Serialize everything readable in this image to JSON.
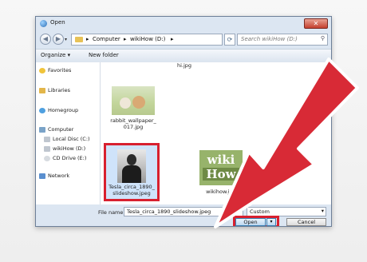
{
  "window": {
    "title": "Open",
    "close_glyph": "✕"
  },
  "address": {
    "back_glyph": "◀",
    "forward_glyph": "▶",
    "crumbs": [
      "Computer",
      "wikiHow (D:)"
    ],
    "separator": "▸",
    "refresh_glyph": "⟳",
    "search_placeholder": "Search wikiHow (D:)",
    "search_glyph": "⚲"
  },
  "toolbar": {
    "organize": "Organize ▾",
    "new_folder": "New folder"
  },
  "sidebar": {
    "items": [
      {
        "label": "Favorites",
        "icon": "star-icon"
      },
      {
        "label": "Libraries",
        "icon": "library-icon"
      },
      {
        "label": "Homegroup",
        "icon": "homegroup-icon"
      },
      {
        "label": "Computer",
        "icon": "computer-icon"
      },
      {
        "label": "Local Disc (C:)",
        "icon": "disk-icon"
      },
      {
        "label": "wikiHow (D:)",
        "icon": "disk-icon"
      },
      {
        "label": "CD Drive (E:)",
        "icon": "cd-icon"
      },
      {
        "label": "Network",
        "icon": "network-icon"
      }
    ]
  },
  "files": {
    "top_partial": "hi.jpg",
    "rabbit": {
      "line1": "rabbit_wallpaper_",
      "line2": "017.jpg"
    },
    "tesla": {
      "line1": "Tesla_circa_1890_",
      "line2": "slideshow.jpeg"
    },
    "wikihow": {
      "name": "wikihow.jpg",
      "logo_top": "wiki",
      "logo_bottom": "How"
    }
  },
  "bottom": {
    "file_name_label": "File name:",
    "file_name_value": "Tesla_circa_1890_slideshow.jpeg",
    "filter_value": "Custom",
    "filter_glyph": "▾",
    "open_label": "Open",
    "open_dropdown_glyph": "▾",
    "cancel_label": "Cancel"
  },
  "colors": {
    "highlight": "#d8202f",
    "arrow": "#d82a36",
    "selection": "#cfe3fa"
  }
}
